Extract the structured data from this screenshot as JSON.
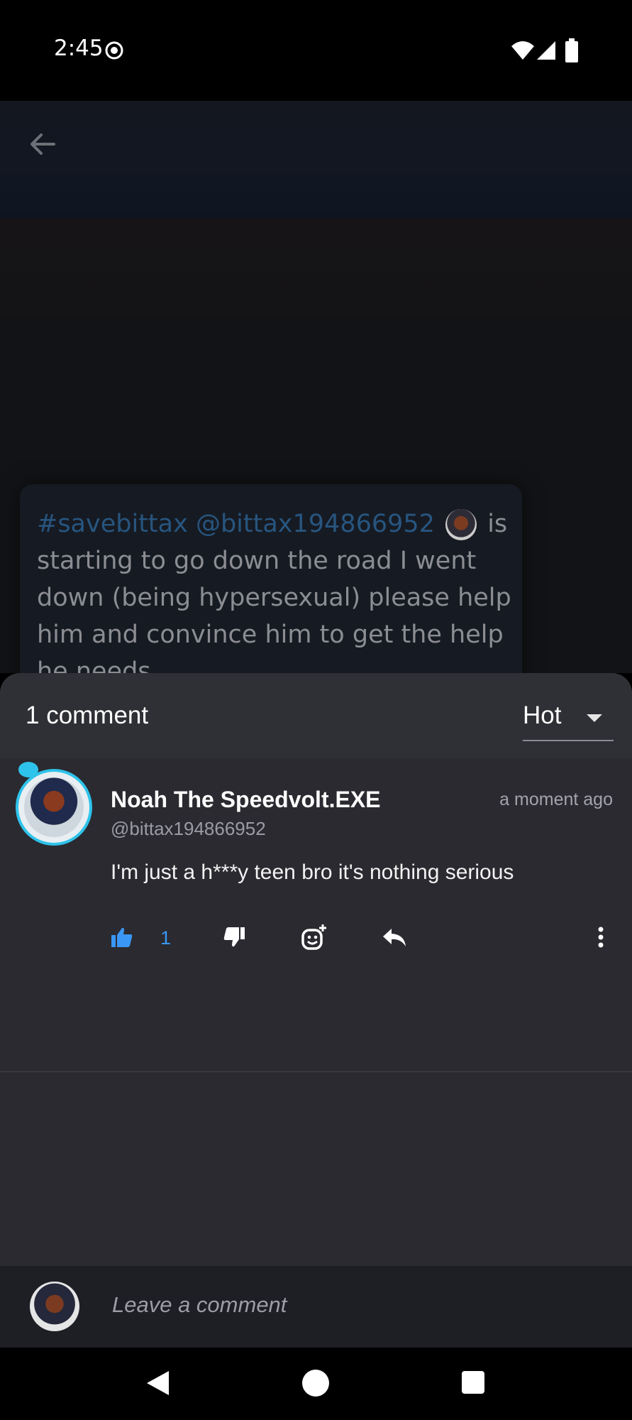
{
  "status_bar": {
    "time": "2:45"
  },
  "post": {
    "hashtag": "#savebittax",
    "mention": "@bittax194866952",
    "text_after_avatar": "is starting to go down the road I went down (being hypersexual) please help him and convince him to get the help he needs"
  },
  "comments_sheet": {
    "count_label": "1 comment",
    "sort": {
      "selected": "Hot"
    },
    "comments": [
      {
        "author": "Noah The Speedvolt.EXE",
        "handle": "@bittax194866952",
        "time": "a moment ago",
        "body": "I'm just a h***y teen bro it's nothing serious",
        "likes": "1"
      }
    ],
    "compose": {
      "placeholder": "Leave a comment"
    }
  },
  "colors": {
    "accent": "#3b97f5",
    "avatar_ring": "#2ec3ea",
    "sheet_bg": "#2a2a30"
  },
  "icons": [
    "record-icon",
    "wifi-icon",
    "signal-icon",
    "battery-icon",
    "back-arrow-icon",
    "thumbs-up-icon",
    "thumbs-down-icon",
    "add-reaction-icon",
    "reply-icon",
    "more-vertical-icon"
  ]
}
